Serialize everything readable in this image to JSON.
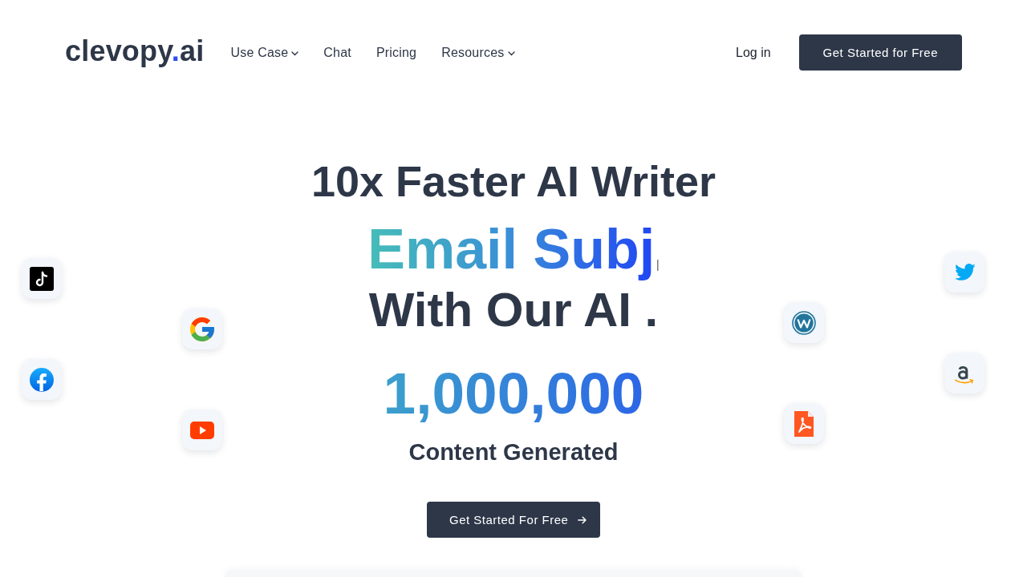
{
  "header": {
    "logo": {
      "name": "clevopy",
      "dot": ".",
      "suffix": "ai"
    },
    "nav": [
      {
        "label": "Use Case",
        "dropdown": true
      },
      {
        "label": "Chat",
        "dropdown": false
      },
      {
        "label": "Pricing",
        "dropdown": false
      },
      {
        "label": "Resources",
        "dropdown": true
      }
    ],
    "login": "Log in",
    "cta": "Get Started for Free"
  },
  "hero": {
    "title": "10x Faster AI Writer",
    "typed_text": "Email Subj",
    "cursor": "|",
    "tagline": "With Our AI .",
    "counter": "1,000,000",
    "counter_label": "Content Generated",
    "cta": "Get Started For Free"
  }
}
